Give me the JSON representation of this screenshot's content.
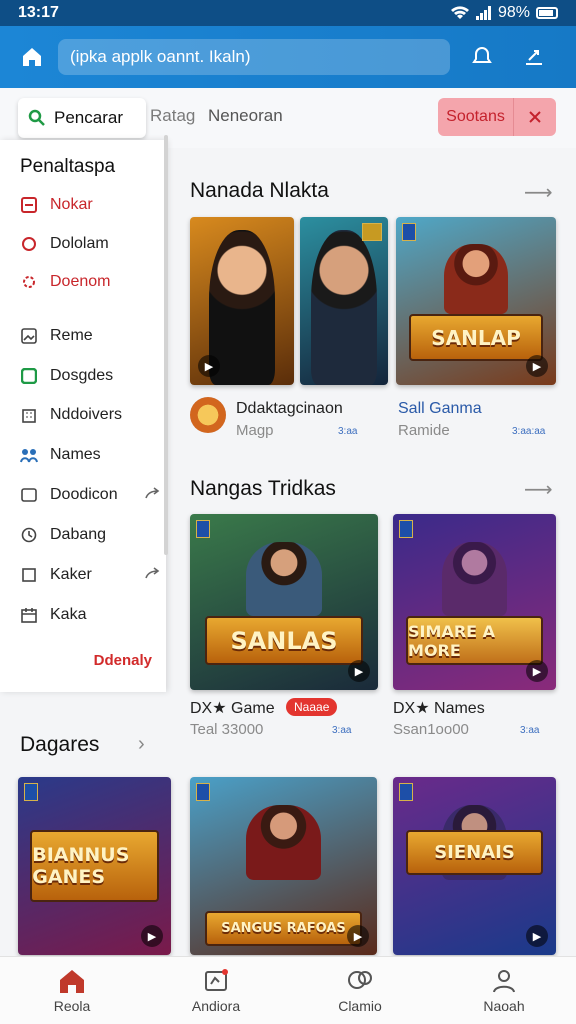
{
  "status": {
    "time": "13:17",
    "battery": "98%"
  },
  "appbar": {
    "url_text": "(ipka applk oannt. Ikaln)"
  },
  "search": {
    "active_tab": "Pencarar",
    "tab2": "Ratag",
    "tab3": "Neneoran",
    "pill_label": "Sootans"
  },
  "drawer": {
    "title": "Penaltaspa",
    "items": [
      {
        "label": "Nokar",
        "icon": "square-icon",
        "red": true
      },
      {
        "label": "Dololam",
        "icon": "comment-icon",
        "red": false
      },
      {
        "label": "Doenom",
        "icon": "gear-icon",
        "red": true
      },
      {
        "label": "Reme",
        "icon": "image-icon",
        "red": false
      },
      {
        "label": "Dosgdes",
        "icon": "green-box-icon",
        "red": false
      },
      {
        "label": "Nddoivers",
        "icon": "building-icon",
        "red": false
      },
      {
        "label": "Names",
        "icon": "people-icon",
        "red": false
      },
      {
        "label": "Doodicon",
        "icon": "screen-icon",
        "red": false
      },
      {
        "label": "Dabang",
        "icon": "clock-icon",
        "red": false
      },
      {
        "label": "Kaker",
        "icon": "box-icon",
        "red": false
      },
      {
        "label": "Kaka",
        "icon": "calendar-icon",
        "red": false
      }
    ],
    "footer": "Ddenaly"
  },
  "section1": {
    "title": "Nanada Nlakta",
    "cards": [
      {
        "caption1": "Ddaktagcinaon",
        "caption2": "Magp",
        "stat": "3:aa"
      },
      {
        "caption1": "Sall Ganma",
        "caption2": "Ramide",
        "stat": "3:aa:aa",
        "banner": "SANLAP"
      }
    ]
  },
  "section2": {
    "title": "Nangas Tridkas",
    "cards": [
      {
        "caption1": "DX★ Game",
        "badge": "Naaae",
        "caption2": "Teal 33000",
        "stat": "3:aa",
        "banner": "SANLAS"
      },
      {
        "caption1": "DX★ Names",
        "caption2": "Ssan1oo00",
        "stat": "3:aa",
        "banner": "SIMARE A MORE"
      }
    ]
  },
  "section3": {
    "title": "Dagares",
    "cards": [
      {
        "banner": "BIANNUS GANES"
      },
      {
        "banner": "SANGUS RAFOAS"
      },
      {
        "banner": "SIENAIS"
      }
    ]
  },
  "bottomnav": [
    {
      "label": "Reola",
      "icon": "home-icon"
    },
    {
      "label": "Andiora",
      "icon": "gamepad-icon"
    },
    {
      "label": "Clamio",
      "icon": "chat-icon"
    },
    {
      "label": "Naoah",
      "icon": "profile-icon"
    }
  ]
}
